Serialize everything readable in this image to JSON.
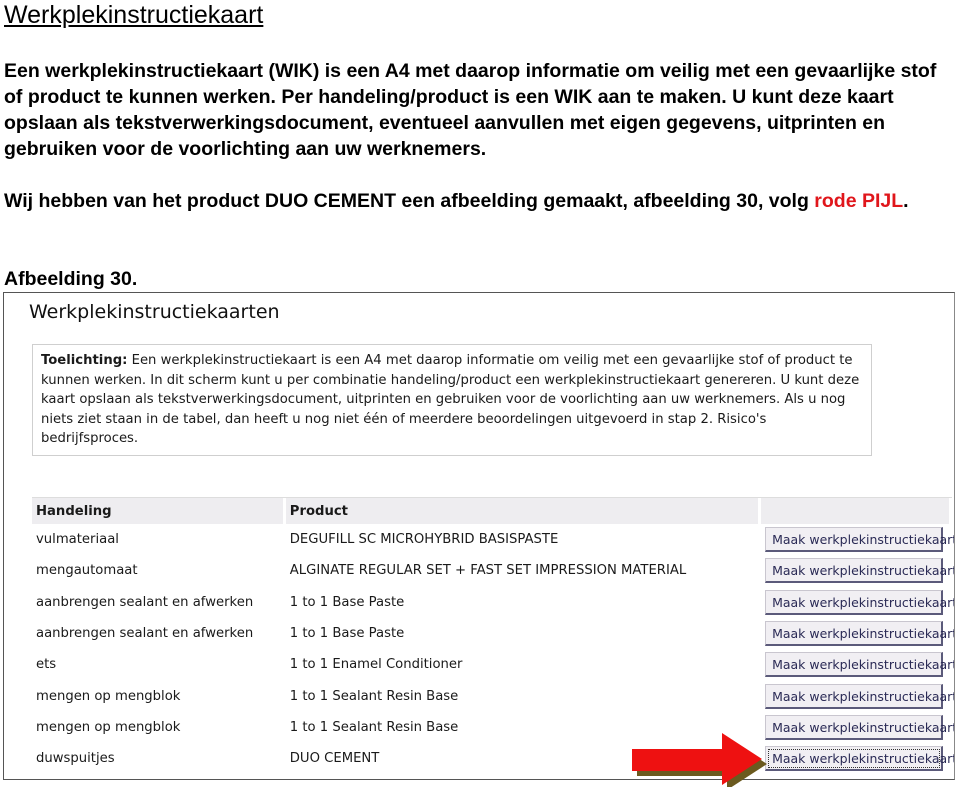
{
  "document": {
    "title": "Werkplekinstructiekaart",
    "paragraph1": "Een werkplekinstructiekaart (WIK) is een A4 met daarop informatie om veilig met een gevaarlijke stof of product te kunnen werken. Per handeling/product is een WIK aan te maken. U kunt deze kaart opslaan als tekstverwerkingsdocument, eventueel aanvullen met eigen gegevens, uitprinten en gebruiken voor de voorlichting aan uw werknemers.",
    "paragraph2_before": "Wij hebben van het product DUO CEMENT een afbeelding gemaakt, afbeelding 30, volg ",
    "paragraph2_red": "rode PIJL",
    "paragraph2_after": ".",
    "figure_caption": "Afbeelding 30.",
    "accent_red": "#e0161b"
  },
  "screenshot": {
    "title": "Werkplekinstructiekaarten",
    "info_label": "Toelichting:",
    "info_text": " Een werkplekinstructiekaart is een A4 met daarop informatie om veilig met een gevaarlijke stof of product te kunnen werken. In dit scherm kunt u per combinatie handeling/product een werkplekinstructiekaart genereren. U kunt deze kaart opslaan als tekstverwerkingsdocument, uitprinten en gebruiken voor de voorlichting aan uw werknemers. Als u nog niets ziet staan in de tabel, dan heeft u nog niet één of meerdere beoordelingen uitgevoerd in stap 2. Risico's bedrijfsproces.",
    "table": {
      "headers": [
        "Handeling",
        "Product",
        ""
      ],
      "button_label": "Maak werkplekinstructiekaart",
      "rows": [
        {
          "handeling": "vulmateriaal",
          "product": "DEGUFILL SC MICROHYBRID BASISPASTE"
        },
        {
          "handeling": "mengautomaat",
          "product": "ALGINATE REGULAR SET + FAST SET IMPRESSION MATERIAL"
        },
        {
          "handeling": "aanbrengen sealant en afwerken",
          "product": "1 to 1 Base Paste"
        },
        {
          "handeling": "aanbrengen sealant en afwerken",
          "product": "1 to 1 Base Paste"
        },
        {
          "handeling": "ets",
          "product": "1 to 1 Enamel Conditioner"
        },
        {
          "handeling": "mengen op mengblok",
          "product": "1 to 1 Sealant Resin Base"
        },
        {
          "handeling": "mengen op mengblok",
          "product": "1 to 1 Sealant Resin Base"
        },
        {
          "handeling": "duwspuitjes",
          "product": "DUO CEMENT"
        }
      ]
    }
  }
}
